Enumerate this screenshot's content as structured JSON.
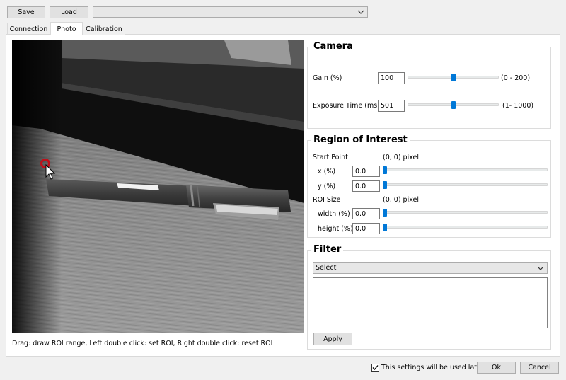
{
  "toolbar": {
    "save_label": "Save",
    "load_label": "Load",
    "preset_value": ""
  },
  "tabs": [
    {
      "label": "Connection"
    },
    {
      "label": "Photo"
    },
    {
      "label": "Calibration"
    }
  ],
  "preview": {
    "hint": "Drag: draw ROI range, Left double click: set ROI, Right double click: reset ROI"
  },
  "camera": {
    "title": "Camera",
    "gain_label": "Gain (%)",
    "gain_value": "100",
    "gain_range": "(0 - 200)",
    "gain_fraction": 0.5,
    "exposure_label": "Exposure Time (ms)",
    "exposure_value": "501",
    "exposure_range": "(1- 1000)",
    "exposure_fraction": 0.5
  },
  "roi": {
    "title": "Region of Interest",
    "start_label": "Start Point",
    "start_value": "(0, 0) pixel",
    "x_label": "x (%)",
    "x_value": "0.0",
    "y_label": "y (%)",
    "y_value": "0.0",
    "size_label": "ROI Size",
    "size_value": "(0, 0) pixel",
    "width_label": "width (%)",
    "width_value": "0.0",
    "height_label": "height (%)",
    "height_value": "0.0"
  },
  "filter": {
    "title": "Filter",
    "select_value": "Select",
    "params_text": "",
    "apply_label": "Apply"
  },
  "footer": {
    "checkbox_checked": true,
    "checkbox_label": "This settings will be used later.",
    "ok_label": "Ok",
    "cancel_label": "Cancel"
  },
  "colors": {
    "accent": "#0078d7",
    "window_bg": "#f0f0f0",
    "cursor_marker": "#c0101a"
  }
}
